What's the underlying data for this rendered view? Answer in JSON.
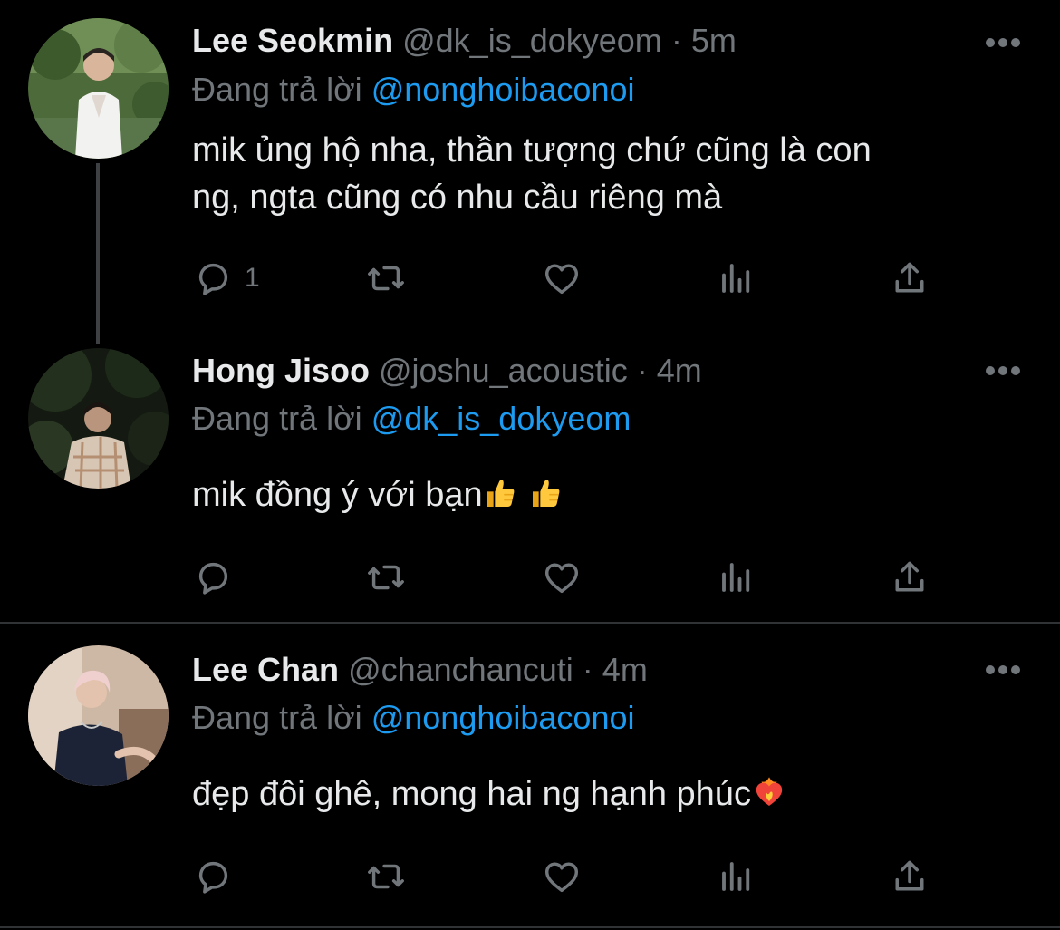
{
  "tweets": [
    {
      "display_name": "Lee Seokmin",
      "handle": "@dk_is_dokyeom",
      "separator": "·",
      "time": "5m",
      "reply_prefix": "Đang trả lời",
      "reply_target": "@nonghoibaconoi",
      "text_line1": "mik ủng hộ nha, thần tượng chứ cũng là con",
      "text_line2": "ng, ngta cũng có nhu cầu riêng mà",
      "reply_count": "1",
      "icons": [
        "reply-icon",
        "retweet-icon",
        "like-icon",
        "analytics-icon",
        "share-icon",
        "more-icon"
      ]
    },
    {
      "display_name": "Hong Jisoo",
      "handle": "@joshu_acoustic",
      "separator": "·",
      "time": "4m",
      "reply_prefix": "Đang trả lời",
      "reply_target": "@dk_is_dokyeom",
      "text": "mik đồng ý với bạn",
      "emojis": [
        "thumbs-up-emoji",
        "thumbs-up-emoji"
      ]
    },
    {
      "display_name": "Lee Chan",
      "handle": "@chanchancuti",
      "separator": "·",
      "time": "4m",
      "reply_prefix": "Đang trả lời",
      "reply_target": "@nonghoibaconoi",
      "text": "đẹp đôi ghê, mong hai ng hạnh phúc",
      "emojis": [
        "heart-on-fire-emoji"
      ]
    }
  ],
  "colors": {
    "background": "#000000",
    "text": "#e7e9ea",
    "muted": "#71767b",
    "link": "#1d9bf0",
    "divider": "#2f3336",
    "thread_line": "#3e4144"
  }
}
